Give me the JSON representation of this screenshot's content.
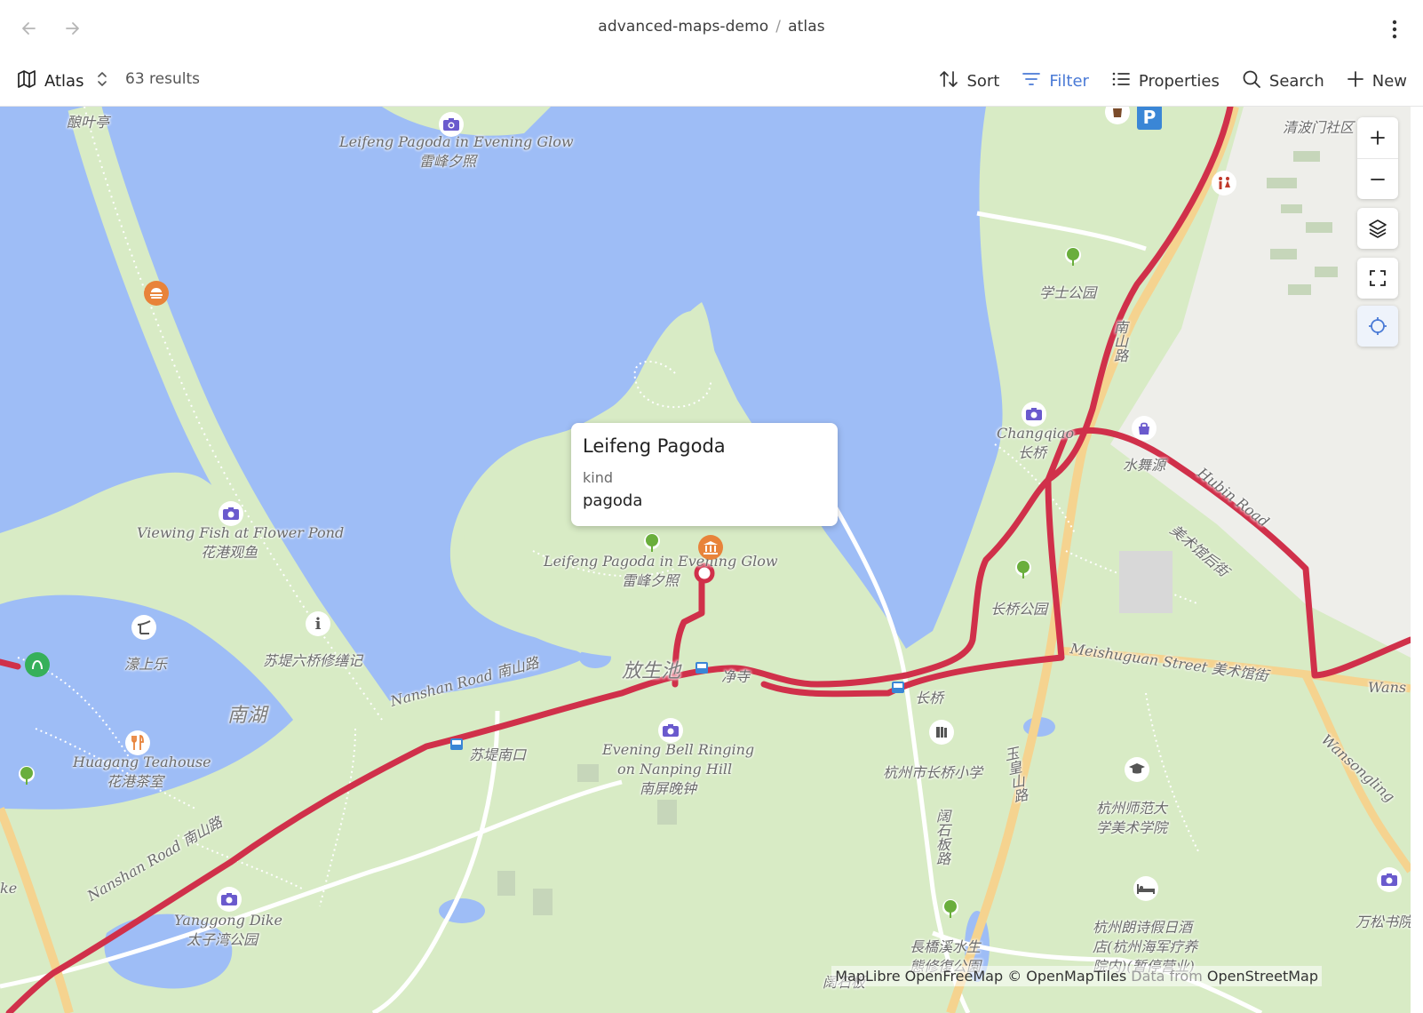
{
  "header": {
    "breadcrumb_repo": "advanced-maps-demo",
    "breadcrumb_sep": "/",
    "breadcrumb_page": "atlas"
  },
  "toolbar": {
    "view_label": "Atlas",
    "results": "63 results",
    "sort": "Sort",
    "filter": "Filter",
    "properties": "Properties",
    "search": "Search",
    "new": "New"
  },
  "colors": {
    "accent": "#4a7ad6",
    "water": "#9ebdf6",
    "park": "#d8ebc5",
    "route": "#d0304a",
    "road_major": "#f5d38f"
  },
  "popup": {
    "title": "Leifeng Pagoda",
    "key": "kind",
    "value": "pagoda"
  },
  "map": {
    "labels": {
      "niangyeting": "酿叶亭",
      "leifeng_glow_en_top": "Leifeng Pagoda in Evening Glow",
      "leifeng_glow_cn_top": "雷峰夕照",
      "qingbomen": "清波门社区",
      "xueshi_park": "学士公园",
      "nanshan_lu": "南山路",
      "changqiao_en": "Changqiao",
      "changqiao_cn": "长桥",
      "shuiwuyuan": "水舞源",
      "meishuguan_hou": "美术馆后街",
      "hubin_road": "Hubin Road",
      "viewing_fish_en": "Viewing Fish at Flower Pond",
      "viewing_fish_cn": "花港观鱼",
      "leifeng_glow_en": "Leifeng Pagoda in Evening Glow",
      "leifeng_glow_cn": "雷峰夕照",
      "changqiao_park": "长桥公园",
      "haoshangle": "濠上乐",
      "sudi_liuqiao": "苏堤六桥修缮记",
      "fangsheng": "放生池",
      "jingsi": "净寺",
      "meishuguan_street": "Meishuguan Street 美术馆街",
      "wans": "Wans",
      "nanhu": "南湖",
      "nanshan_road": "Nanshan Road 南山路",
      "sudi_nankou": "苏堤南口",
      "evening_bell_1": "Evening Bell Ringing",
      "evening_bell_2": "on Nanping Hill",
      "evening_bell_cn": "南屏晚钟",
      "changqiao_stop": "长桥",
      "yuhuangshan": "玉皇山路",
      "huagang_en": "Huagang Teahouse",
      "huagang_cn": "花港茶室",
      "hangzhou_school": "杭州市长桥小学",
      "kuoshiban": "阔石板路",
      "normal_univ_1": "杭州师范大",
      "normal_univ_2": "学美术学院",
      "wansongling": "Wansongling",
      "nanshan_road_2": "Nanshan Road 南山路",
      "yanggong_en": "Yanggong Dike",
      "yanggong_cn": "太子湾公园",
      "wansong_cn": "万松书院",
      "hotel_1": "杭州朗诗假日酒",
      "hotel_2": "店(杭州海军疗养",
      "hotel_3": "院内)(暂停营业)",
      "changqiao_xi_1": "長橋溪水生",
      "changqiao_xi_2": "態修復公園",
      "kuoshiban_2": "阔石板",
      "ke": "ke"
    },
    "attribution": {
      "maplibre": "MapLibre",
      "openfreemap": "OpenFreeMap",
      "openmaptiles": "© OpenMapTiles",
      "data_from": "Data from",
      "osm": "OpenStreetMap"
    }
  }
}
